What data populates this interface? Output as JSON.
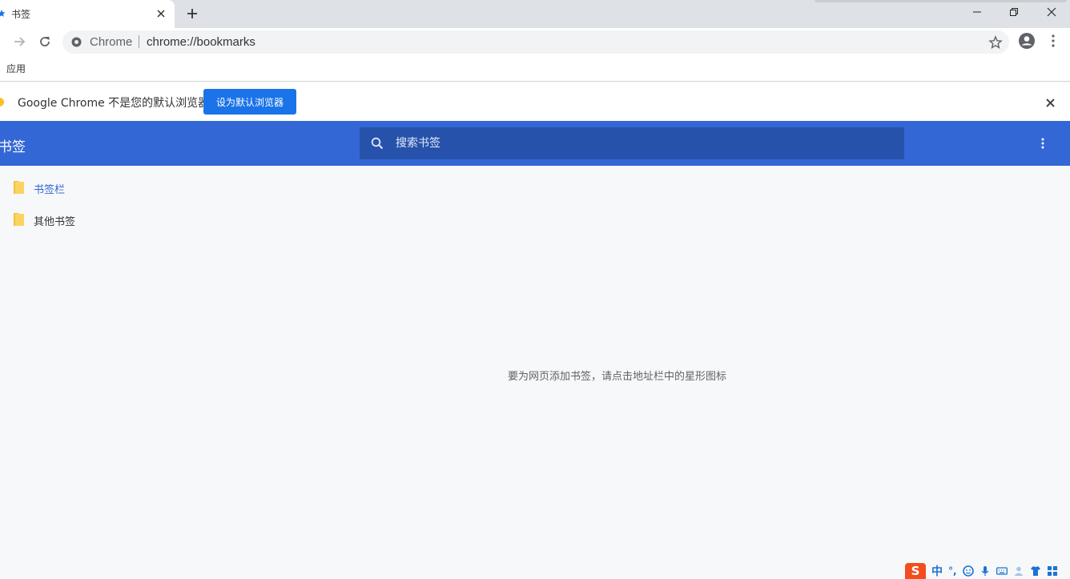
{
  "browser": {
    "tab_title": "书签",
    "omnibox_chip": "Chrome",
    "url": "chrome://bookmarks",
    "bookmarks_bar_apps": "应用"
  },
  "infobar": {
    "message": "Google Chrome 不是您的默认浏览器",
    "button_label": "设为默认浏览器"
  },
  "bookmarks": {
    "title": "书签",
    "search_placeholder": "搜索书签",
    "folders": [
      {
        "label": "书签栏",
        "selected": true
      },
      {
        "label": "其他书签",
        "selected": false
      }
    ],
    "empty_message": "要为网页添加书签，请点击地址栏中的星形图标"
  },
  "ime": {
    "logo": "S",
    "mode": "中",
    "punct": "°,"
  },
  "colors": {
    "accent": "#3367d6",
    "search_bg": "#2752ab",
    "button_blue": "#1a73e8",
    "folder_yellow": "#fbd460",
    "selected_text": "#3367d6"
  }
}
